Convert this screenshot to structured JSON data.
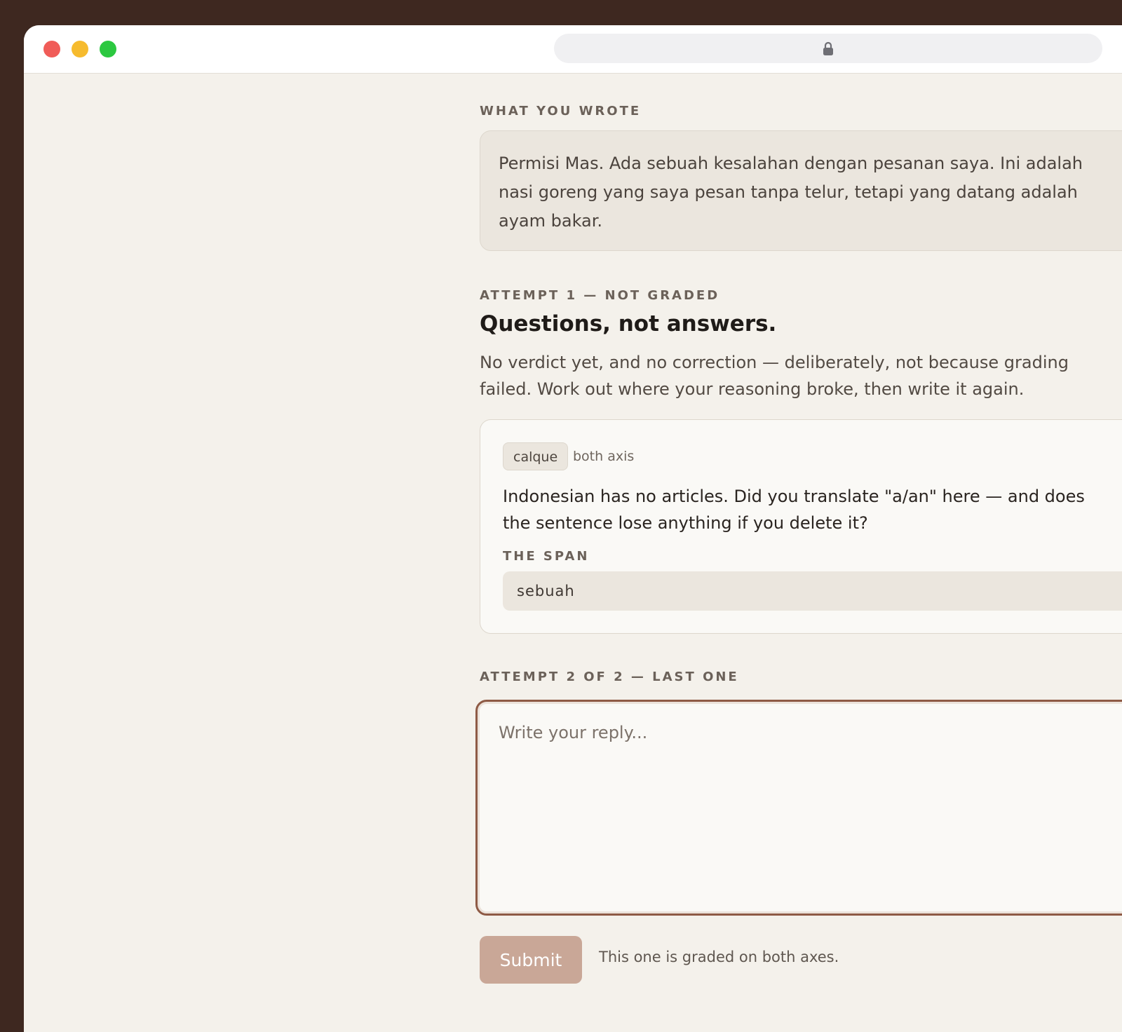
{
  "browser": {
    "address": ""
  },
  "wrote": {
    "label": "WHAT YOU WROTE",
    "text": "Permisi Mas. Ada sebuah kesalahan dengan pesanan saya. Ini adalah nasi goreng yang saya pesan tanpa telur, tetapi yang datang adalah ayam bakar."
  },
  "attempt1": {
    "label": "ATTEMPT 1 — NOT GRADED",
    "headline": "Questions, not answers.",
    "intro": "No verdict yet, and no correction — deliberately, not because grading failed. Work out where your reasoning broke, then write it again.",
    "question": {
      "tag": "calque",
      "axis": "both axis",
      "text": "Indonesian has no articles. Did you translate \"a/an\" here — and does the sentence lose anything if you delete it?",
      "span_label": "THE SPAN",
      "span": "sebuah"
    }
  },
  "attempt2": {
    "label": "ATTEMPT 2 OF 2 — LAST ONE",
    "placeholder": "Write your reply...",
    "value": "",
    "submit_label": "Submit",
    "note": "This one is graded on both axes."
  },
  "colors": {
    "background": "#f4f1eb",
    "accent": "#8e5a45",
    "submit": "#c9a797"
  }
}
